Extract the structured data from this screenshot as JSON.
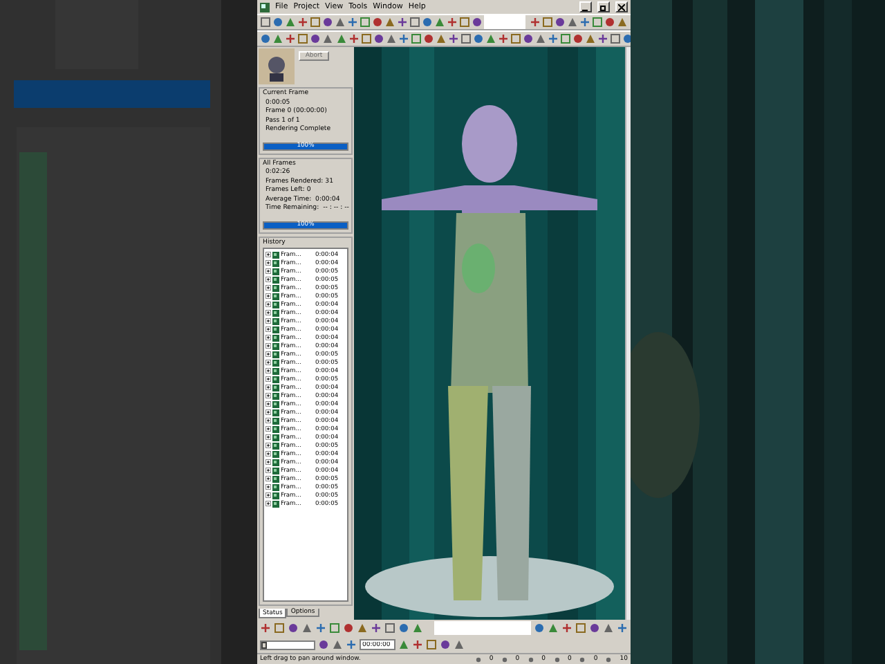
{
  "menu": [
    "File",
    "Project",
    "View",
    "Tools",
    "Window",
    "Help"
  ],
  "abort_button": {
    "label": "Abort",
    "disabled": true
  },
  "current_frame": {
    "title": "Current Frame",
    "lines": [
      "0:00:05",
      "Frame 0 (00:00:00)",
      "Pass 1 of 1",
      "Rendering Complete"
    ],
    "progress": {
      "level": 1,
      "label": "100%"
    }
  },
  "all_frames": {
    "title": "All Frames",
    "lines": [
      "0:02:26",
      "Frames Rendered: 31",
      "Frames Left: 0",
      "Average Time:  0:00:04",
      "Time Remaining:  -- : -- : --"
    ],
    "progress": {
      "level": 1,
      "label": "100%"
    }
  },
  "history": {
    "title": "History",
    "rows": [
      {
        "name": "Fram...",
        "time": "0:00:04"
      },
      {
        "name": "Fram...",
        "time": "0:00:04"
      },
      {
        "name": "Fram...",
        "time": "0:00:05"
      },
      {
        "name": "Fram...",
        "time": "0:00:05"
      },
      {
        "name": "Fram...",
        "time": "0:00:05"
      },
      {
        "name": "Fram...",
        "time": "0:00:05"
      },
      {
        "name": "Fram...",
        "time": "0:00:04"
      },
      {
        "name": "Fram...",
        "time": "0:00:04"
      },
      {
        "name": "Fram...",
        "time": "0:00:04"
      },
      {
        "name": "Fram...",
        "time": "0:00:04"
      },
      {
        "name": "Fram...",
        "time": "0:00:04"
      },
      {
        "name": "Fram...",
        "time": "0:00:04"
      },
      {
        "name": "Fram...",
        "time": "0:00:05"
      },
      {
        "name": "Fram...",
        "time": "0:00:05"
      },
      {
        "name": "Fram...",
        "time": "0:00:04"
      },
      {
        "name": "Fram...",
        "time": "0:00:05"
      },
      {
        "name": "Fram...",
        "time": "0:00:04"
      },
      {
        "name": "Fram...",
        "time": "0:00:04"
      },
      {
        "name": "Fram...",
        "time": "0:00:04"
      },
      {
        "name": "Fram...",
        "time": "0:00:04"
      },
      {
        "name": "Fram...",
        "time": "0:00:04"
      },
      {
        "name": "Fram...",
        "time": "0:00:04"
      },
      {
        "name": "Fram...",
        "time": "0:00:04"
      },
      {
        "name": "Fram...",
        "time": "0:00:05"
      },
      {
        "name": "Fram...",
        "time": "0:00:04"
      },
      {
        "name": "Fram...",
        "time": "0:00:04"
      },
      {
        "name": "Fram...",
        "time": "0:00:04"
      },
      {
        "name": "Fram...",
        "time": "0:00:05"
      },
      {
        "name": "Fram...",
        "time": "0:00:05"
      },
      {
        "name": "Fram...",
        "time": "0:00:05"
      },
      {
        "name": "Fram...",
        "time": "0:00:05"
      }
    ]
  },
  "tabs": [
    {
      "label": "Status",
      "selected": true
    },
    {
      "label": "Options",
      "selected": false
    }
  ],
  "timeline": {
    "level": 0
  },
  "time_field": {
    "value": "00:00:00"
  },
  "status_bar": {
    "message": "Left drag to pan around window.",
    "readings": [
      "0",
      "0",
      "0",
      "0",
      "0",
      "10"
    ]
  }
}
